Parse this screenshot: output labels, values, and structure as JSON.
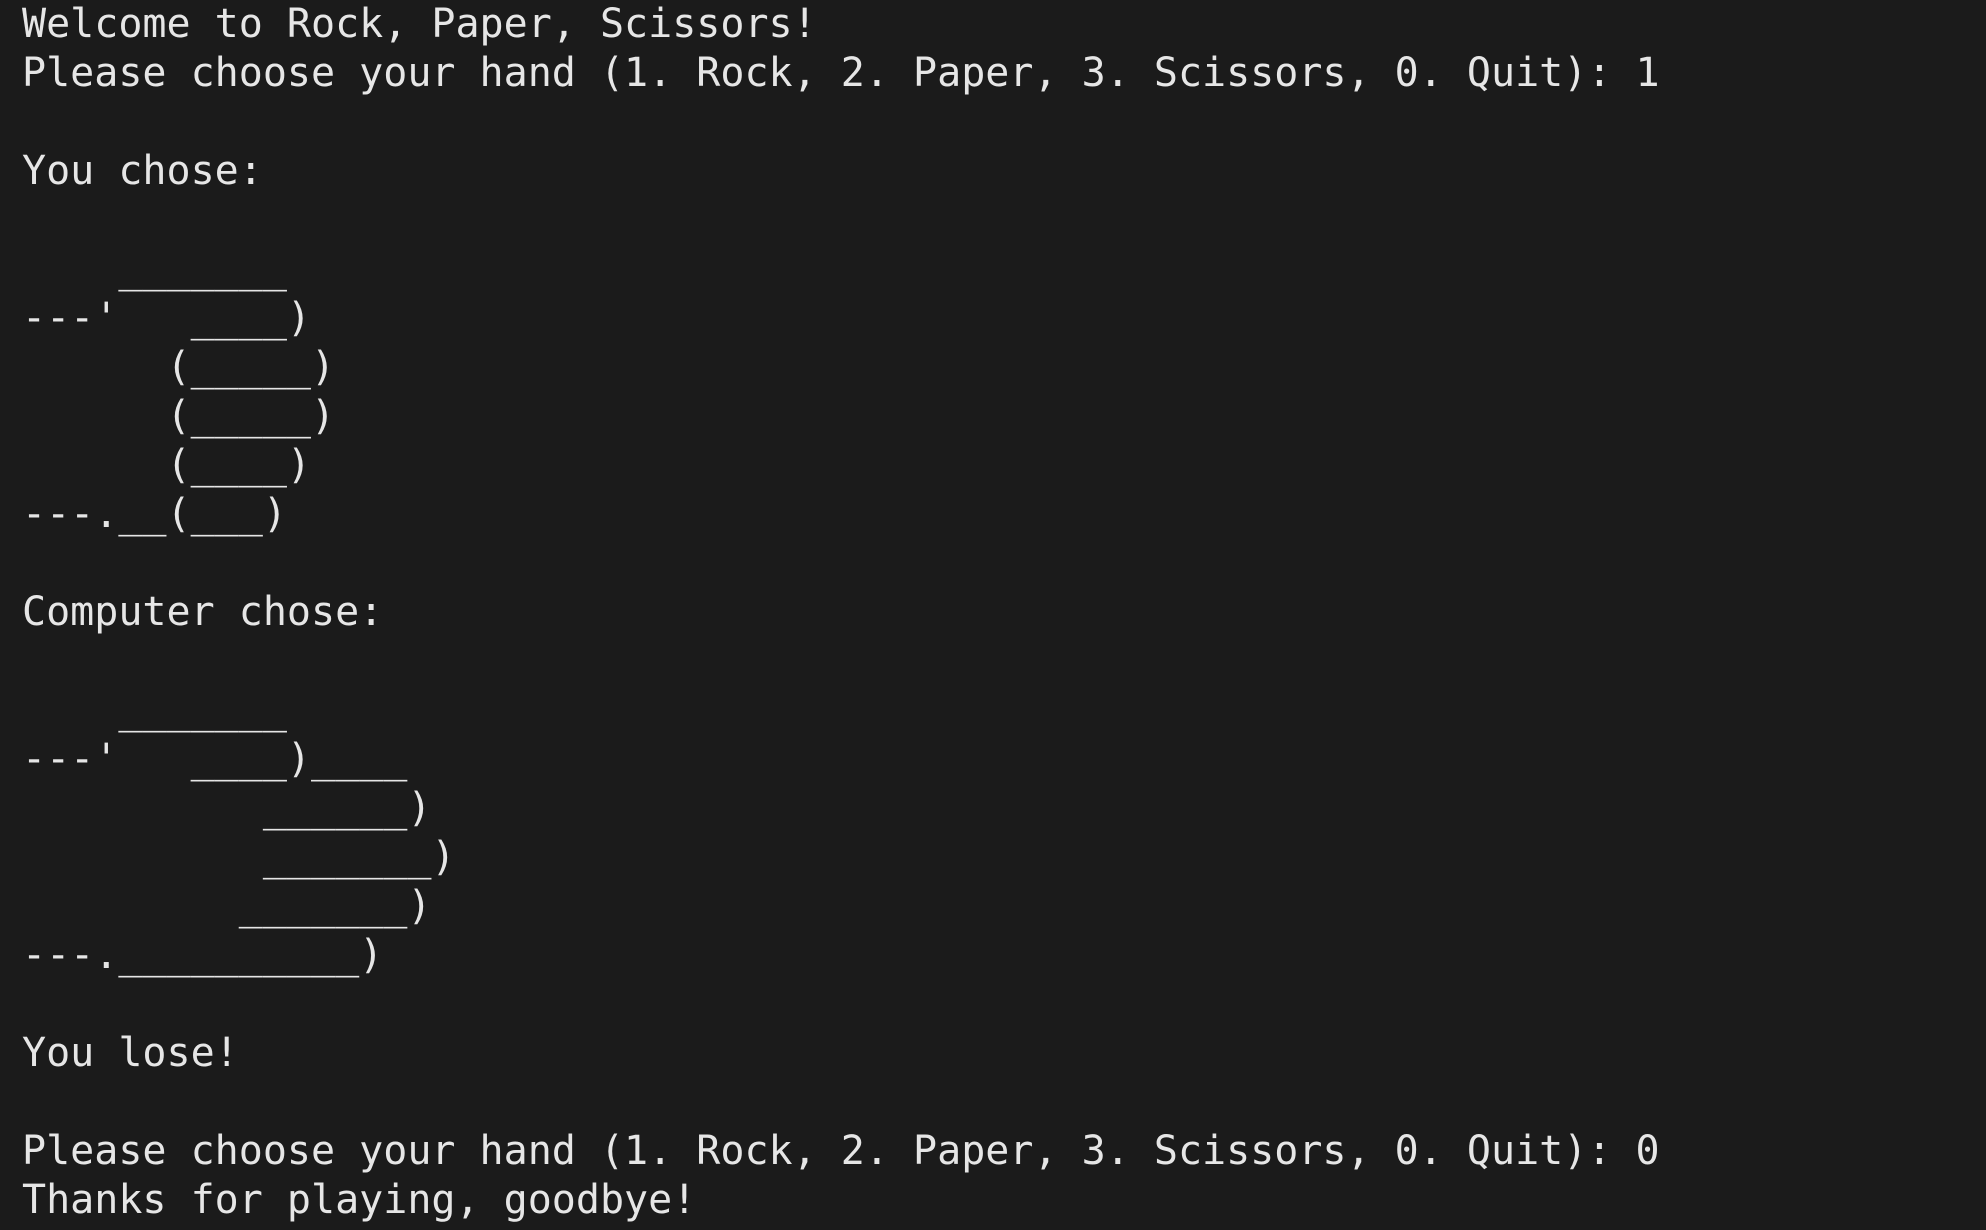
{
  "terminal": {
    "welcome": "Welcome to Rock, Paper, Scissors!",
    "prompt1": "Please choose your hand (1. Rock, 2. Paper, 3. Scissors, 0. Quit): 1",
    "you_chose_label": "You chose:",
    "player_art": [
      "    _______",
      "---'   ____)",
      "      (_____)",
      "      (_____)",
      "      (____)",
      "---.__(___)"
    ],
    "computer_chose_label": "Computer chose:",
    "computer_art": [
      "    _______",
      "---'   ____)____",
      "          ______)",
      "          _______)",
      "         _______)",
      "---.__________)"
    ],
    "result": "You lose!",
    "prompt2": "Please choose your hand (1. Rock, 2. Paper, 3. Scissors, 0. Quit): 0",
    "goodbye": "Thanks for playing, goodbye!"
  }
}
